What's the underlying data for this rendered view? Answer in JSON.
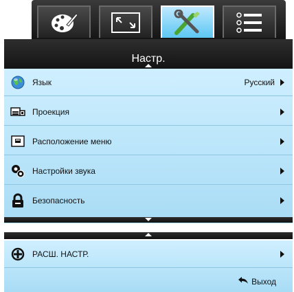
{
  "tabs": [
    {
      "name": "image-tab",
      "icon": "palette-icon"
    },
    {
      "name": "display-tab",
      "icon": "fullscreen-icon"
    },
    {
      "name": "setup-tab",
      "icon": "tools-icon",
      "active": true
    },
    {
      "name": "options-tab",
      "icon": "list-icon"
    }
  ],
  "header": {
    "title": "Настр."
  },
  "menu": {
    "items": [
      {
        "label": "Язык",
        "value": "Русский",
        "icon": "globe-icon"
      },
      {
        "label": "Проекция",
        "icon": "projection-icon"
      },
      {
        "label": "Расположение меню",
        "icon": "menu-location-icon"
      },
      {
        "label": "Настройки звука",
        "icon": "audio-settings-icon"
      },
      {
        "label": "Безопасность",
        "icon": "lock-icon"
      }
    ]
  },
  "advanced": {
    "label": "РАСШ. НАСТР.",
    "icon": "plus-circle-icon"
  },
  "footer": {
    "exit_label": "Выход",
    "icon": "back-arrow-icon"
  },
  "colors": {
    "accent": "#5cc7f2",
    "panel": "#bfe6fa",
    "bar": "#1a1a1a"
  }
}
